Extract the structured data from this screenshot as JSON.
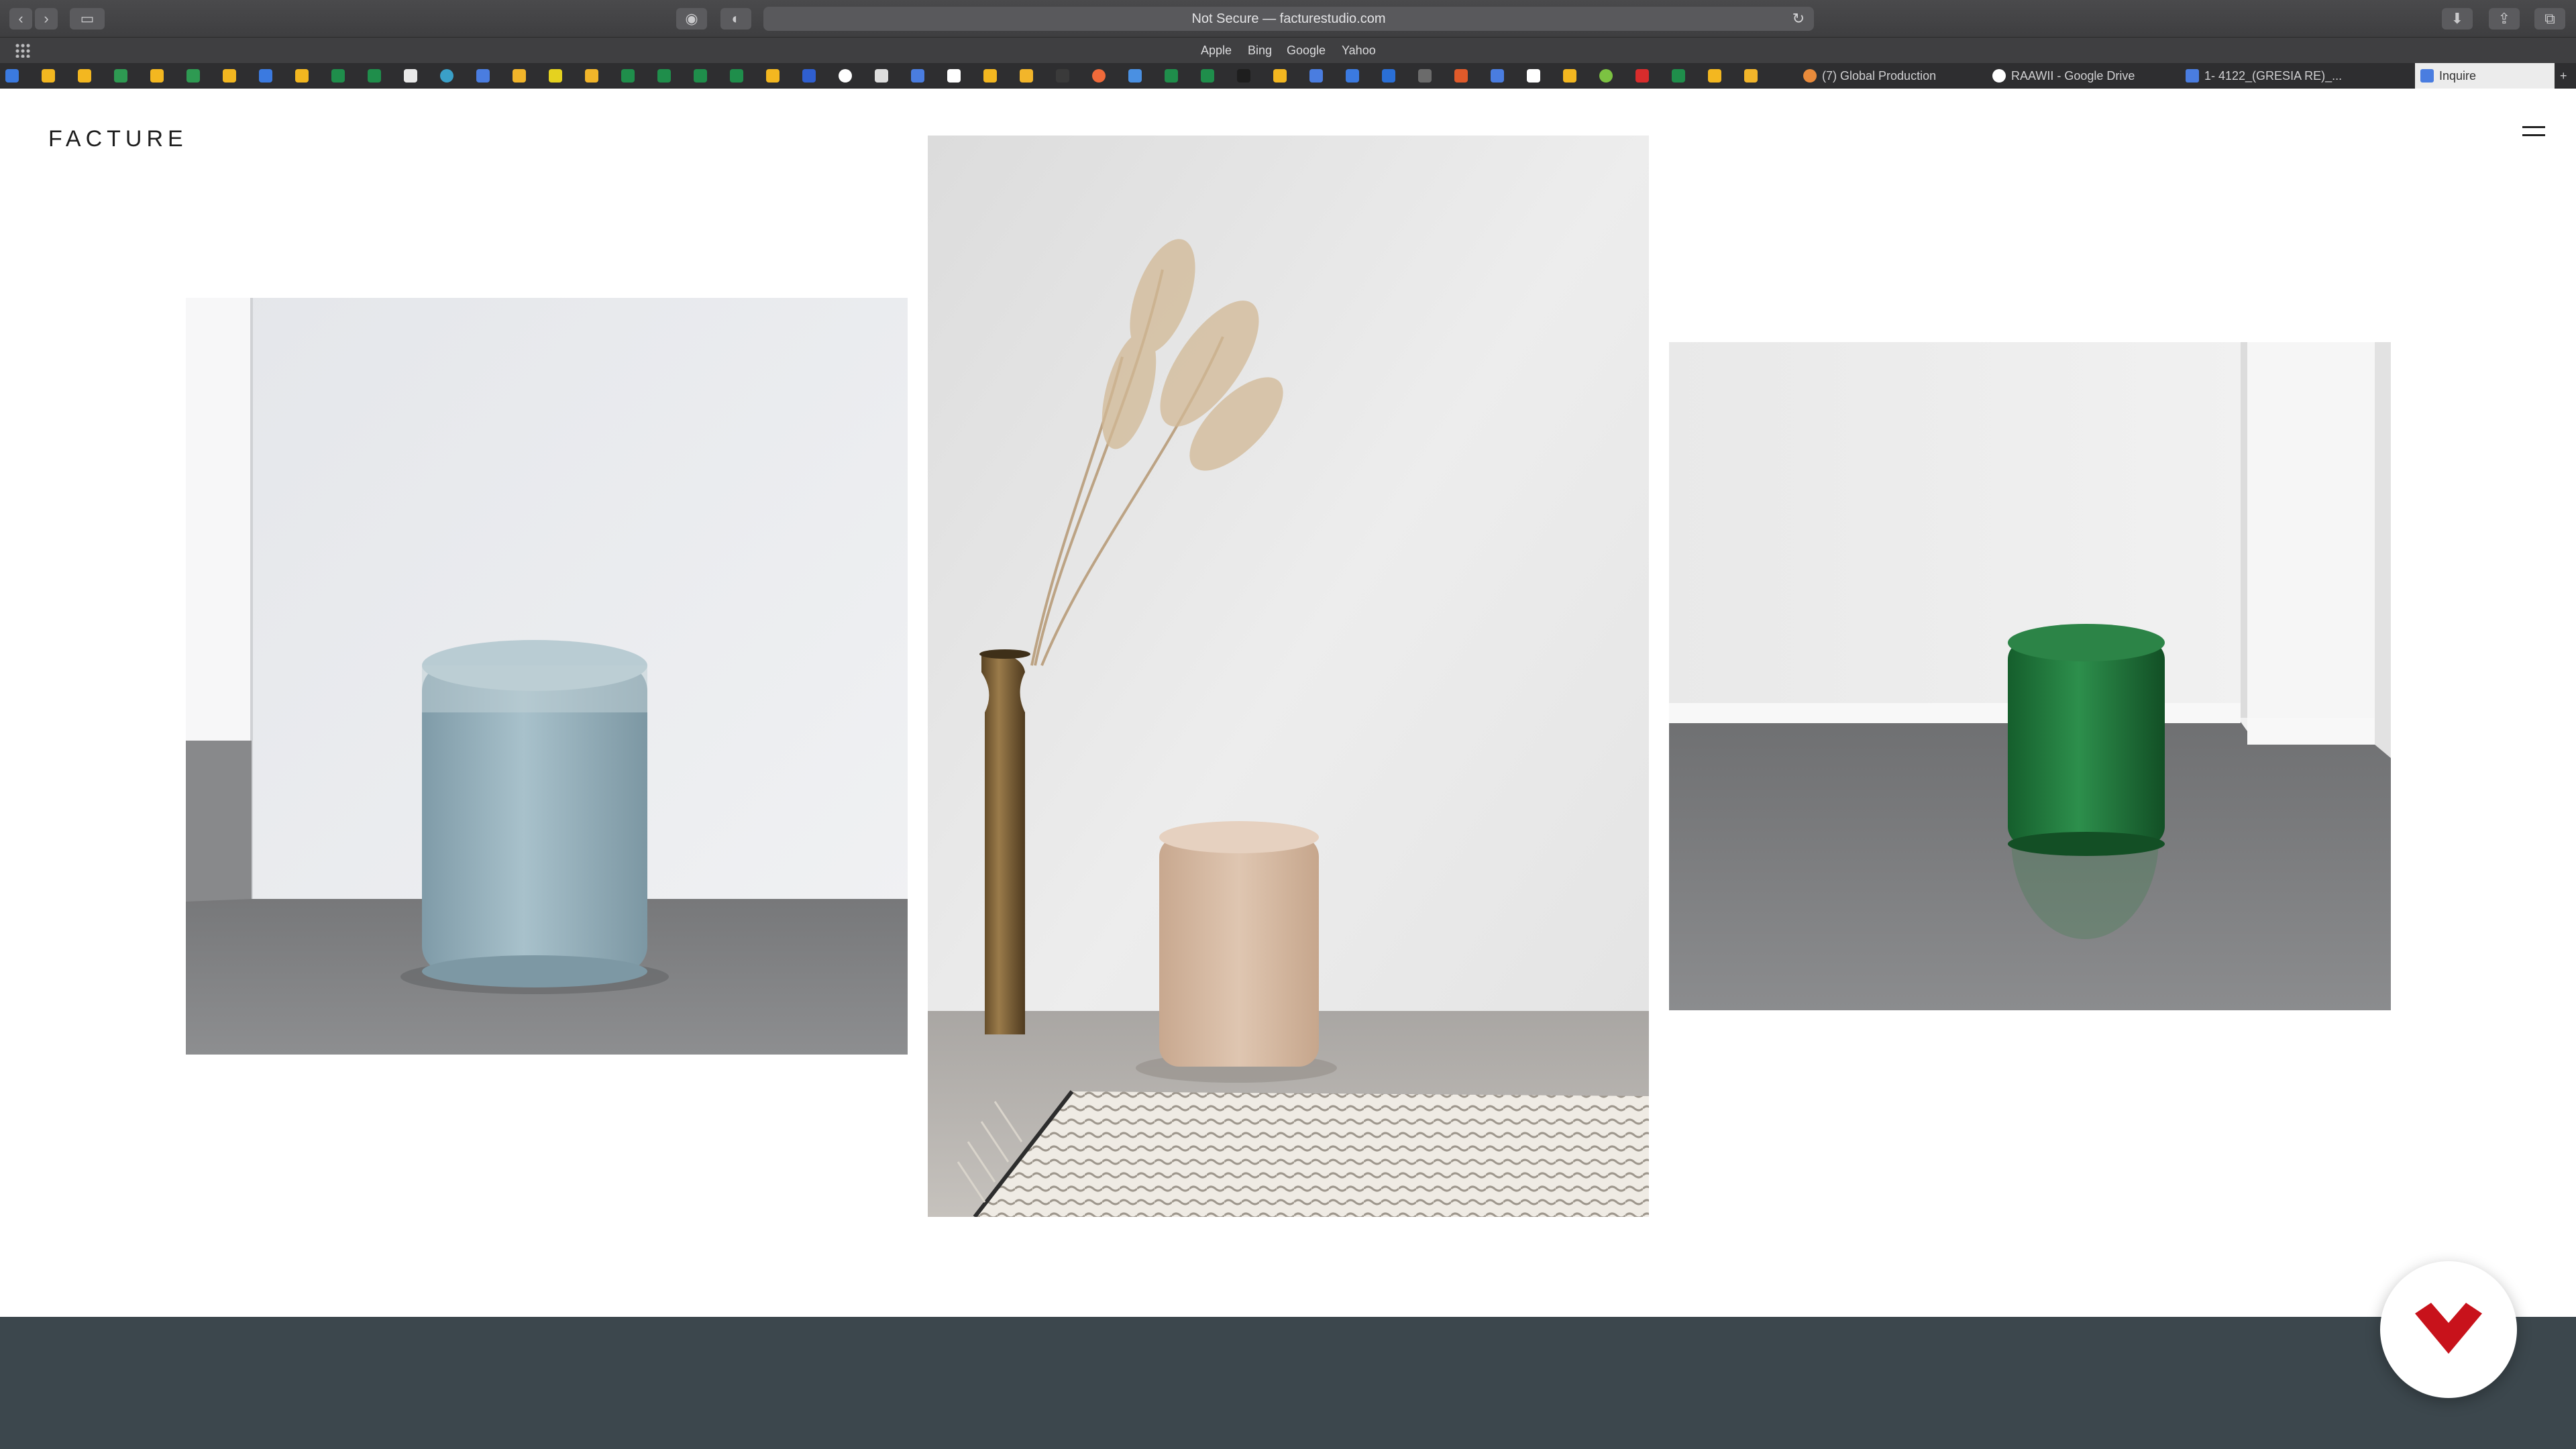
{
  "browser": {
    "address": "Not Secure — facturestudio.com",
    "favorites": [
      "Apple",
      "Bing",
      "Google",
      "Yahoo"
    ],
    "tabs": [
      {
        "label": "(7) Global Production",
        "icon": "global-production-icon"
      },
      {
        "label": "RAAWII - Google Drive",
        "icon": "google-icon"
      },
      {
        "label": "1- 4122_(GRESIA RE)_...",
        "icon": "docs-icon"
      },
      {
        "label": "Inquire",
        "icon": "facture-icon",
        "active": true
      }
    ]
  },
  "site": {
    "logo": "FACTURE",
    "gallery": [
      {
        "name": "blue-resin-stool-photo",
        "color": "#93aeb9"
      },
      {
        "name": "nude-resin-stool-photo",
        "color": "#d7bba3"
      },
      {
        "name": "green-resin-stool-photo",
        "color": "#1f7a3b"
      }
    ],
    "footer_color": "#3c474d",
    "chat_icon": "chevron-chat-icon",
    "chat_color": "#c8121b"
  }
}
